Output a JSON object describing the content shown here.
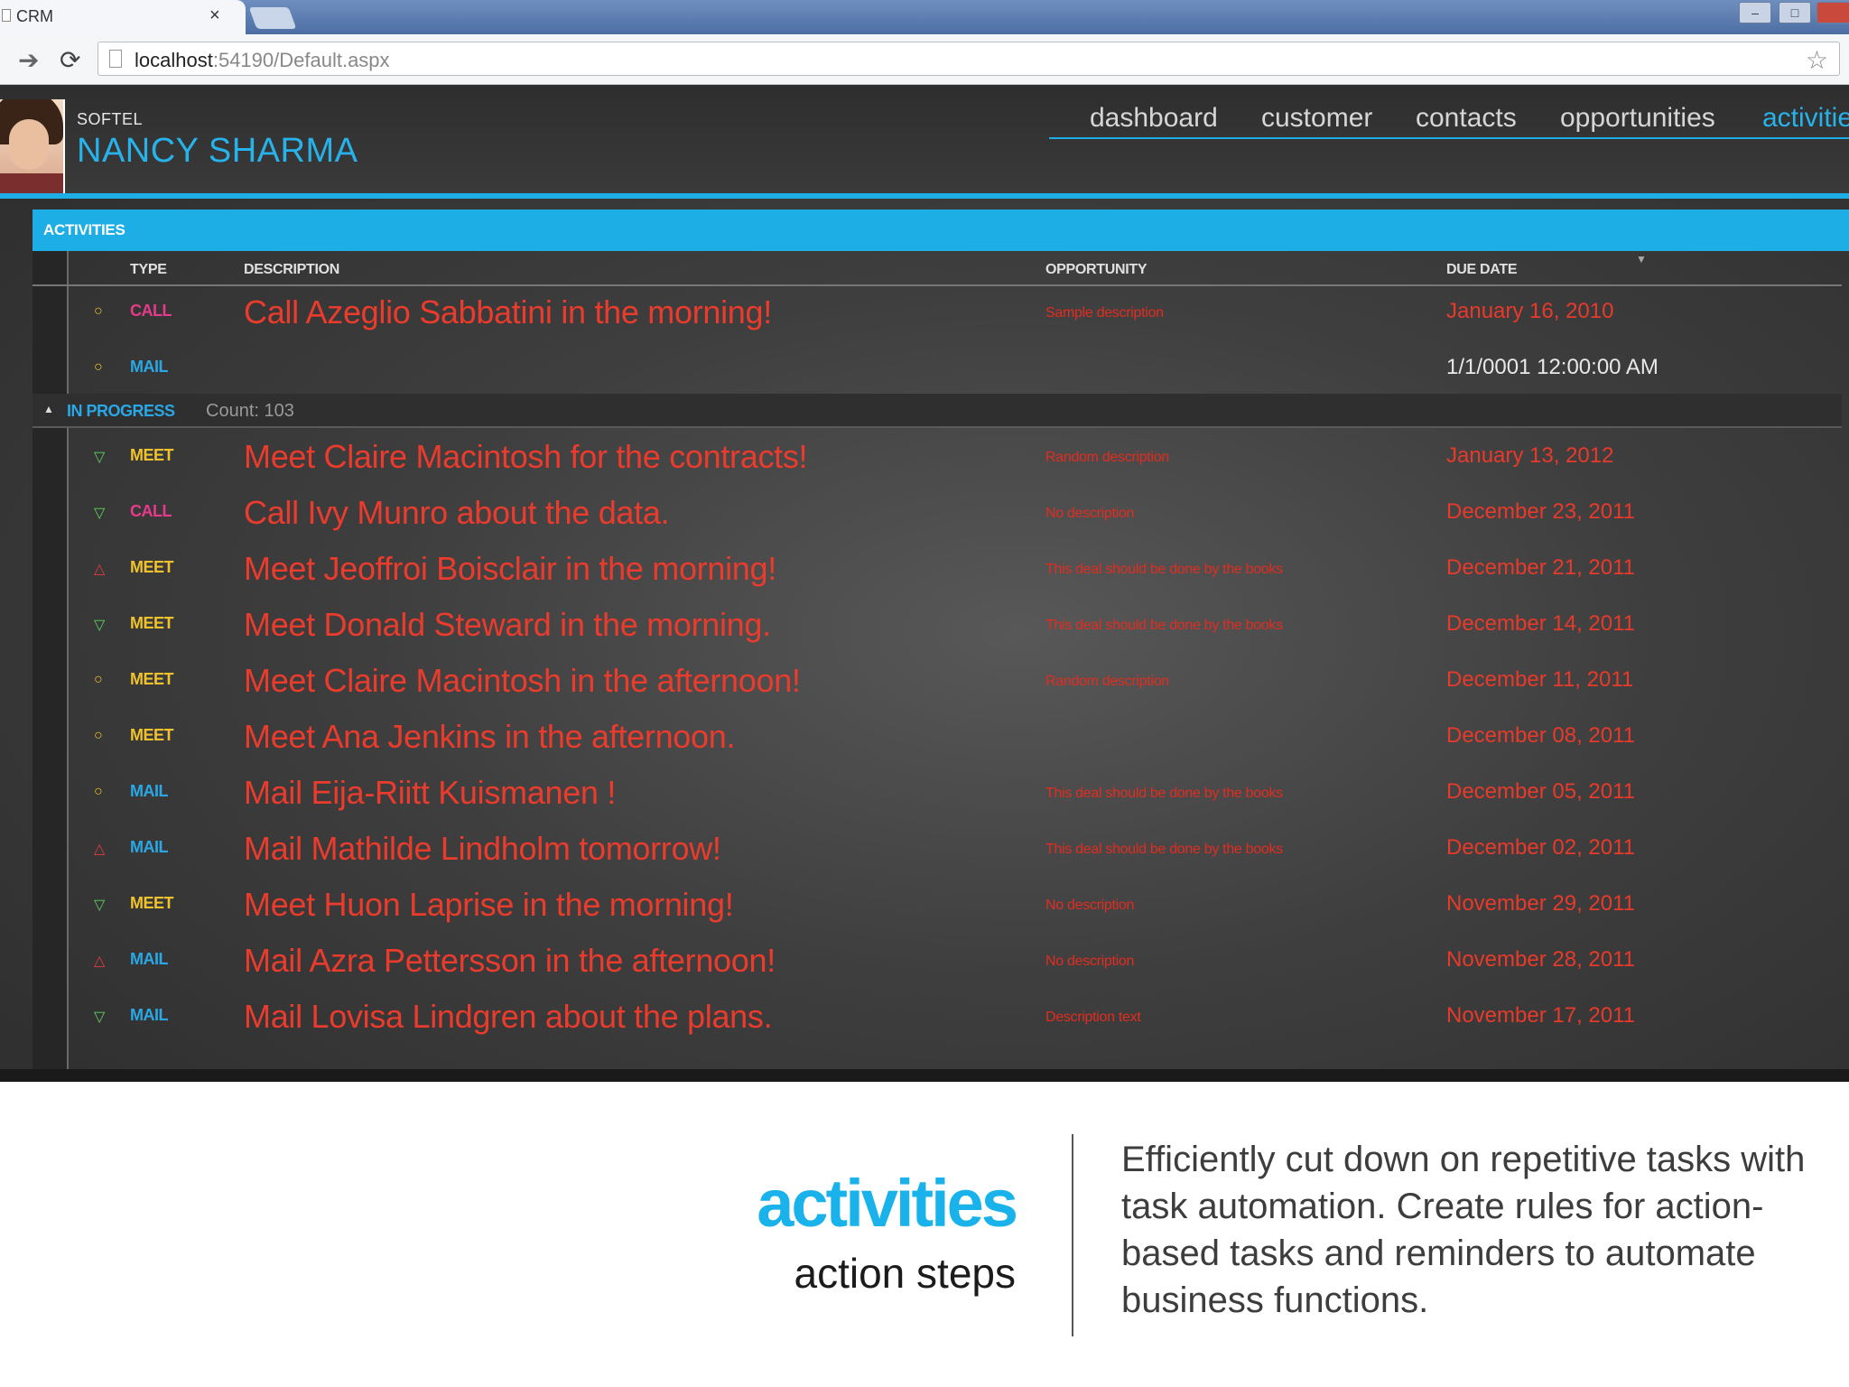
{
  "browser": {
    "tab_title": "CRM",
    "tab_close": "×",
    "url_host": "localhost",
    "url_rest": ":54190/Default.aspx",
    "window_controls": {
      "minimize": "–",
      "maximize": "□",
      "close": ""
    }
  },
  "header": {
    "company": "SOFTEL",
    "user_name": "NANCY SHARMA",
    "nav": [
      "dashboard",
      "customer",
      "contacts",
      "opportunities",
      "activitie"
    ],
    "active_nav": "activitie"
  },
  "grid": {
    "title": "ACTIVITIES",
    "columns": {
      "type": "TYPE",
      "description": "DESCRIPTION",
      "opportunity": "OPPORTUNITY",
      "due_date": "DUE DATE"
    },
    "top_rows": [
      {
        "icon": "circle",
        "type": "CALL",
        "description": "Call Azeglio Sabbatini in the morning!",
        "opportunity": "Sample description",
        "due": "January 16, 2010"
      },
      {
        "icon": "circle",
        "type": "MAIL",
        "description": "",
        "opportunity": "",
        "due": "1/1/0001 12:00:00 AM"
      }
    ],
    "group": {
      "caret": "▲",
      "name": "IN PROGRESS",
      "count": "Count: 103"
    },
    "rows": [
      {
        "icon": "down",
        "type": "MEET",
        "description": "Meet Claire Macintosh for the contracts!",
        "opportunity": "Random description",
        "due": "January 13, 2012"
      },
      {
        "icon": "down",
        "type": "CALL",
        "description": "Call Ivy Munro about the data.",
        "opportunity": "No description",
        "due": "December 23, 2011"
      },
      {
        "icon": "up",
        "type": "MEET",
        "description": "Meet Jeoffroi Boisclair in the morning!",
        "opportunity": "This deal should be done by the books",
        "due": "December 21, 2011"
      },
      {
        "icon": "down",
        "type": "MEET",
        "description": "Meet Donald Steward in the morning.",
        "opportunity": "This deal should be done by the books",
        "due": "December 14, 2011"
      },
      {
        "icon": "circle",
        "type": "MEET",
        "description": "Meet Claire Macintosh in the afternoon!",
        "opportunity": "Random description",
        "due": "December 11, 2011"
      },
      {
        "icon": "circle",
        "type": "MEET",
        "description": "Meet Ana Jenkins in the afternoon.",
        "opportunity": "",
        "due": "December 08, 2011"
      },
      {
        "icon": "circle",
        "type": "MAIL",
        "description": "Mail Eija-Riitt Kuismanen !",
        "opportunity": "This deal should be done by the books",
        "due": "December 05, 2011"
      },
      {
        "icon": "up",
        "type": "MAIL",
        "description": "Mail Mathilde Lindholm tomorrow!",
        "opportunity": "This deal should be done by the books",
        "due": "December 02, 2011"
      },
      {
        "icon": "down",
        "type": "MEET",
        "description": "Meet Huon Laprise in the morning!",
        "opportunity": "No description",
        "due": "November 29, 2011"
      },
      {
        "icon": "up",
        "type": "MAIL",
        "description": "Mail Azra Pettersson in the afternoon!",
        "opportunity": "No description",
        "due": "November 28, 2011"
      },
      {
        "icon": "down",
        "type": "MAIL",
        "description": "Mail Lovisa Lindgren about the plans.",
        "opportunity": "Description text",
        "due": "November 17, 2011"
      }
    ]
  },
  "caption": {
    "title": "activities",
    "subtitle": "action steps",
    "body": "Efficiently cut down on repetitive tasks with task automation. Create rules for action-based tasks and reminders to automate business functions."
  },
  "colors": {
    "accent": "#1eaee6",
    "description_text": "#ea3b2c",
    "type_call": "#e63b8a",
    "type_mail": "#2aa7e6",
    "type_meet": "#f0c22c",
    "status_low": "#5fd15f",
    "status_high": "#e63b3b",
    "status_normal": "#f0c22c"
  }
}
